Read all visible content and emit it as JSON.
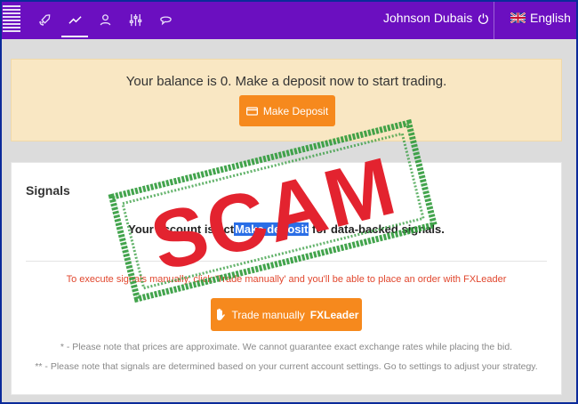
{
  "header": {
    "nav_icons": [
      "rocket-icon",
      "chart-line-icon",
      "user-icon",
      "sliders-icon",
      "chat-icon"
    ],
    "active_icon": "chart-line-icon",
    "user_name": "Johnson Dubais",
    "language": "English"
  },
  "balance": {
    "message": "Your balance is 0. Make a deposit now to start trading.",
    "deposit_button": "Make Deposit"
  },
  "signals": {
    "title": "Signals",
    "account_text_pre": "Your account is ",
    "account_text_obscured": "act",
    "account_link": "Make deposit",
    "account_text_post": " for data-backed signals.",
    "manual_text": "To execute signals manually, click 'Trade manually' and you'll be able to place an order with FXLeader",
    "trade_button": "Trade manually",
    "trade_button_brand": "FXLeader",
    "note1": "* - Please note that prices are approximate. We cannot guarantee exact exchange rates while placing the bid.",
    "note2": "** - Please note that signals are determined based on your current account settings. Go to settings to adjust your strategy."
  },
  "stamp": {
    "text": "SCAM",
    "frame_color": "#2f9a3a",
    "text_color": "#e3232f"
  },
  "colors": {
    "topbar": "#6b0fc0",
    "accent_orange": "#f6891d",
    "balance_bg": "#f9e7c3",
    "warning_red": "#e1472e"
  }
}
